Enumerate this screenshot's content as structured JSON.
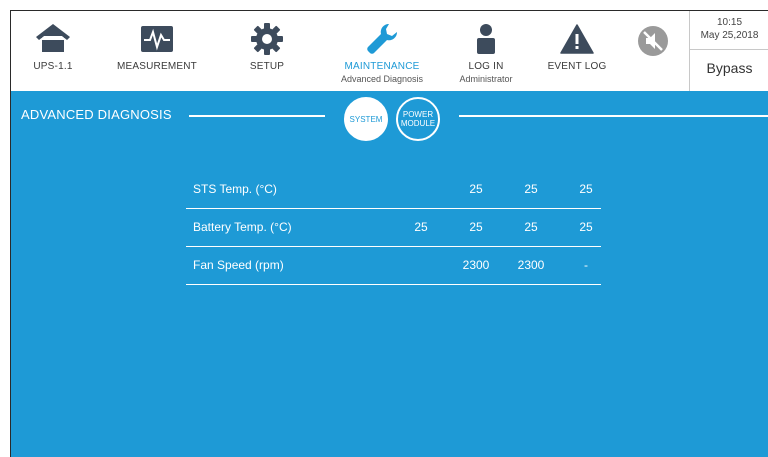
{
  "nav": {
    "items": [
      {
        "label": "UPS-1.1",
        "icon": "home-icon"
      },
      {
        "label": "MEASUREMENT",
        "icon": "waveform-icon"
      },
      {
        "label": "SETUP",
        "icon": "gear-icon"
      },
      {
        "label": "MAINTENANCE",
        "sub": "Advanced Diagnosis",
        "icon": "wrench-icon"
      },
      {
        "label": "LOG IN",
        "sub": "Administrator",
        "icon": "user-icon"
      },
      {
        "label": "EVENT LOG",
        "icon": "warning-icon"
      }
    ],
    "mute_icon": "mute-icon"
  },
  "status": {
    "time": "10:15",
    "date": "May 25,2018",
    "mode": "Bypass"
  },
  "main": {
    "title": "ADVANCED DIAGNOSIS",
    "tabs": [
      {
        "label": "SYSTEM",
        "selected": true
      },
      {
        "label_line1": "POWER",
        "label_line2": "MODULE",
        "selected": false
      }
    ]
  },
  "table": {
    "rows": [
      {
        "label": "STS Temp. (°C)",
        "values": [
          "",
          "25",
          "25",
          "25"
        ]
      },
      {
        "label": "Battery Temp. (°C)",
        "values": [
          "25",
          "25",
          "25",
          "25"
        ]
      },
      {
        "label": "Fan Speed (rpm)",
        "values": [
          "",
          "2300",
          "2300",
          "-"
        ]
      }
    ]
  },
  "colors": {
    "accent": "#1e9ad6",
    "icon": "#3d4b5c",
    "mute_icon": "#9a9a9a"
  }
}
